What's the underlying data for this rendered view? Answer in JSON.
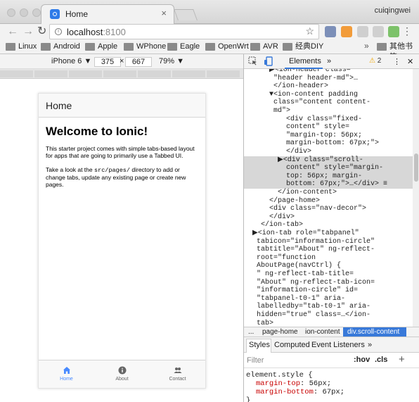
{
  "browser": {
    "tab_title": "Home",
    "tab_close": "×",
    "user_name": "cuiqingwei",
    "url_host": "localhost",
    "url_port": ":8100",
    "bookmarks": [
      "Linux",
      "Android",
      "Apple",
      "WPhone",
      "Eagle",
      "OpenWrt",
      "AVR",
      "经典DIY"
    ],
    "bookmarks_more": "»",
    "other_bookmarks": "其他书签"
  },
  "device_toolbar": {
    "device": "iPhone 6 ▼",
    "width": "375",
    "times": "×",
    "height": "667",
    "zoom": "79% ▼"
  },
  "app": {
    "header_title": "Home",
    "heading": "Welcome to Ionic!",
    "para1": "This starter project comes with simple tabs-based layout for apps that are going to primarily use a Tabbed UI.",
    "para2_a": "Take a look at the ",
    "para2_code": "src/pages/",
    "para2_b": " directory to add or change tabs, update any existing page or create new pages.",
    "tabs": [
      {
        "label": "Home",
        "icon": "home-icon"
      },
      {
        "label": "About",
        "icon": "info-icon"
      },
      {
        "label": "Contact",
        "icon": "contacts-icon"
      }
    ],
    "colors": {
      "active": "#488aff",
      "inactive": "#666666"
    }
  },
  "devtools": {
    "tab_elements": "Elements",
    "more": "»",
    "warn_count": "2",
    "close": "✕",
    "dom_lines": [
      "        </ion-header>",
      "      ▼<ion-content padding",
      "       class=\"content content-",
      "       md\">",
      "          <div class=\"fixed-",
      "          content\" style=",
      "          \"margin-top: 56px;",
      "          margin-bottom: 67px;\">",
      "          </div>",
      "        ▶<div class=\"scroll-",
      "          content\" style=\"margin-",
      "          top: 56px; margin-",
      "          bottom: 67px;\">…</div> ≡",
      "        </ion-content>",
      "      </page-home>",
      "      <div class=\"nav-decor\">",
      "      </div>",
      "    </ion-tab>",
      "  ▶<ion-tab role=\"tabpanel\"",
      "   tabicon=\"information-circle\"",
      "   tabtitle=\"About\" ng-reflect-",
      "   root=\"function",
      "   AboutPage(navCtrl) {",
      "   \" ng-reflect-tab-title=",
      "   \"About\" ng-reflect-tab-icon=",
      "   \"information-circle\" id=",
      "   \"tabpanel-t0-1\" aria-",
      "   labelledby=\"tab-t0-1\" aria-",
      "   hidden=\"true\" class=…</ion-",
      "   tab>"
    ],
    "top_lines": [
      "      ▶<ion-header class=",
      "       \"header header-md\">…",
      "       </ion-header>"
    ],
    "breadcrumbs": [
      "...",
      "page-home",
      "ion-content",
      "div.scroll-content"
    ],
    "style_tabs": [
      "Styles",
      "Computed",
      "Event Listeners",
      "»"
    ],
    "filter_placeholder": "Filter",
    "hov": ":hov",
    "cls": ".cls",
    "plus": "+",
    "rule_selector": "element.style {",
    "rule_prop1": "margin-top",
    "rule_val1": "56px;",
    "rule_prop2": "margin-bottom",
    "rule_val2": "67px;",
    "rule_close": "}"
  }
}
